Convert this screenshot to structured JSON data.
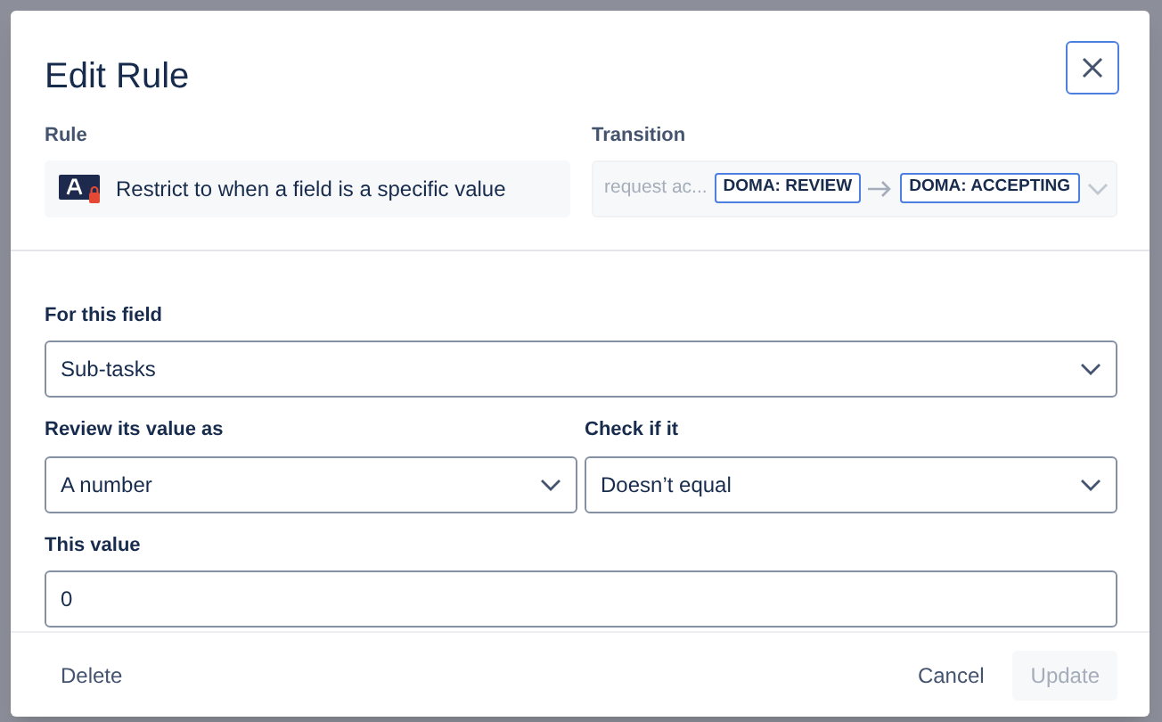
{
  "dialog": {
    "title": "Edit Rule"
  },
  "rule": {
    "label": "Rule",
    "value": "Restrict to when a field is a specific value"
  },
  "transition": {
    "label": "Transition",
    "name": "request ac...",
    "from": "DOMA: REVIEW",
    "to": "DOMA: ACCEPTING",
    "disabled": true
  },
  "field_rows": [
    [
      {
        "kind": "select",
        "label": "For this field",
        "value": "Sub-tasks"
      }
    ],
    [
      {
        "kind": "select",
        "label": "Review its value as",
        "value": "A number"
      },
      {
        "kind": "select",
        "label": "Check if it",
        "value": "Doesn’t equal"
      }
    ],
    [
      {
        "kind": "text",
        "label": "This value",
        "value": "0"
      }
    ]
  ],
  "footer": {
    "delete": "Delete",
    "cancel": "Cancel",
    "update": {
      "label": "Update",
      "disabled": true
    }
  }
}
